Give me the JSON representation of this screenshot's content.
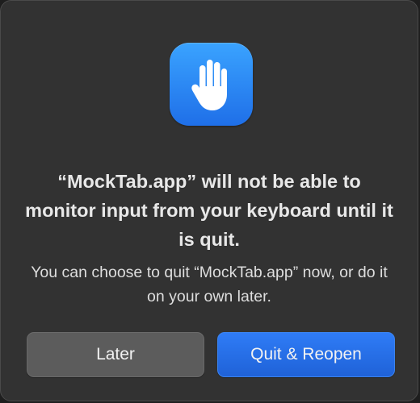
{
  "dialog": {
    "icon": "raised-hand-icon",
    "title": "“MockTab.app” will not be able to monitor input from your keyboard until it is quit.",
    "message": "You can choose to quit “MockTab.app” now, or do it on your own later.",
    "buttons": {
      "later_label": "Later",
      "quit_reopen_label": "Quit & Reopen"
    }
  },
  "colors": {
    "dialog_background": "#323232",
    "icon_gradient_top": "#3aa3ff",
    "icon_gradient_bottom": "#1f6fe8",
    "primary_button": "#2f7cf6",
    "secondary_button": "#5c5c5c"
  }
}
